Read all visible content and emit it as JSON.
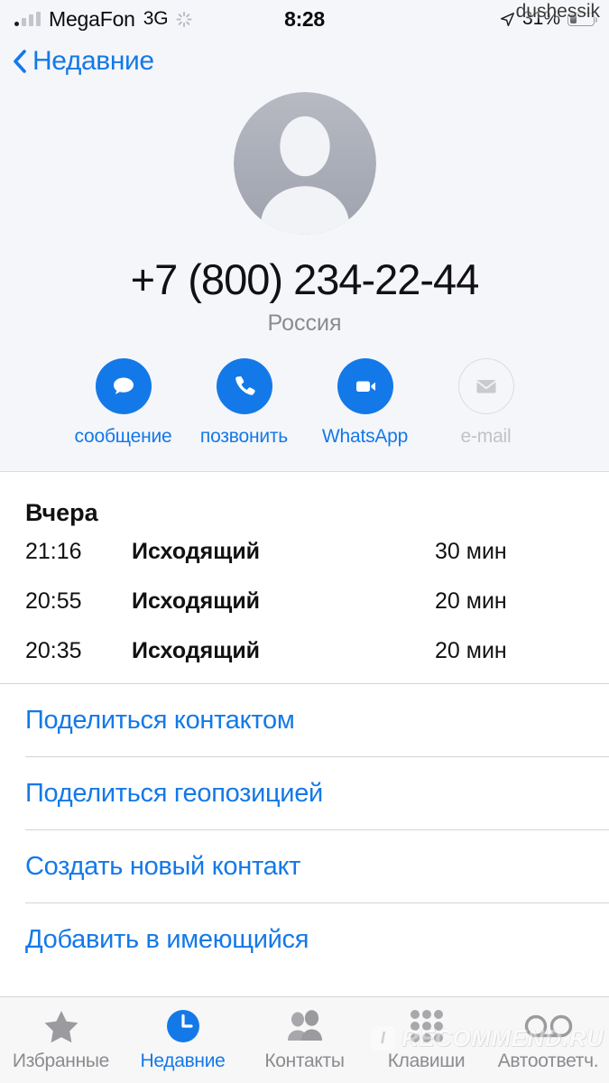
{
  "status_bar": {
    "carrier": "MegaFon",
    "network_type": "3G",
    "time": "8:28",
    "battery_percent": "31%",
    "watermark": "dushessik",
    "icons": [
      "signal-bars-icon",
      "activity-spinner-icon",
      "location-arrow-icon",
      "battery-icon"
    ]
  },
  "nav": {
    "back_label": "Недавние",
    "back_icon": "chevron-left-icon"
  },
  "contact": {
    "avatar_icon": "default-person-avatar-icon",
    "phone_number": "+7 (800) 234-22-44",
    "country": "Россия"
  },
  "actions": [
    {
      "label": "сообщение",
      "icon": "message-bubble-icon",
      "enabled": true
    },
    {
      "label": "позвонить",
      "icon": "phone-handset-icon",
      "enabled": true
    },
    {
      "label": "WhatsApp",
      "icon": "video-camera-icon",
      "enabled": true
    },
    {
      "label": "e-mail",
      "icon": "envelope-icon",
      "enabled": false
    }
  ],
  "call_history": {
    "section_title": "Вчера",
    "rows": [
      {
        "time": "21:16",
        "type": "Исходящий",
        "duration": "30 мин"
      },
      {
        "time": "20:55",
        "type": "Исходящий",
        "duration": "20 мин"
      },
      {
        "time": "20:35",
        "type": "Исходящий",
        "duration": "20 мин"
      }
    ]
  },
  "links": [
    {
      "label": "Поделиться контактом"
    },
    {
      "label": "Поделиться геопозицией"
    },
    {
      "label": "Создать новый контакт"
    },
    {
      "label": "Добавить в имеющийся"
    }
  ],
  "tab_bar": {
    "items": [
      {
        "label": "Избранные",
        "icon": "star-icon",
        "active": false
      },
      {
        "label": "Недавние",
        "icon": "clock-icon",
        "active": true
      },
      {
        "label": "Контакты",
        "icon": "people-icon",
        "active": false
      },
      {
        "label": "Клавиши",
        "icon": "keypad-icon",
        "active": false
      },
      {
        "label": "Автоответч.",
        "icon": "voicemail-icon",
        "active": false
      }
    ]
  },
  "watermark": {
    "badge": "I",
    "text": "RECOMMEND.RU"
  },
  "colors": {
    "accent_blue": "#1479e8",
    "header_bg": "#f5f6fa",
    "disabled_gray": "#c2c2c7",
    "text_primary": "#111113",
    "text_secondary": "#8b8b90"
  }
}
